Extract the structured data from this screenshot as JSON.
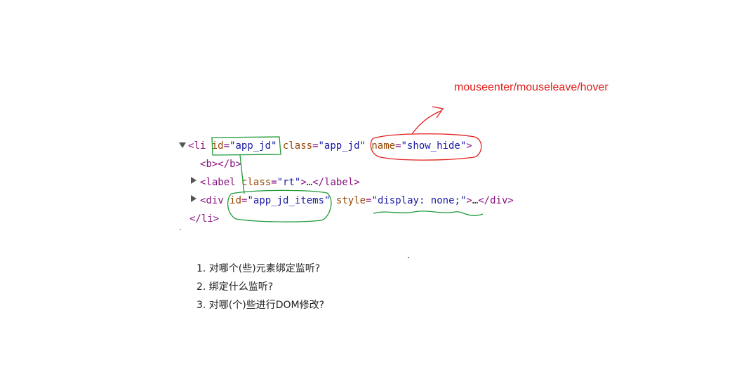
{
  "annotation": {
    "text": "mouseenter/mouseleave/hover",
    "color": "#e0201c"
  },
  "code": {
    "line1": {
      "open": "<",
      "tag": "li",
      "attr1_name": "id",
      "attr1_eq": "=",
      "attr1_value": "\"app_jd\"",
      "attr2_name": "class",
      "attr2_eq": "=",
      "attr2_value": "\"app_jd\"",
      "attr3_name": "name",
      "attr3_eq": "=",
      "attr3_value": "\"show_hide\"",
      "close": ">"
    },
    "line2": {
      "text_open": "<",
      "tag": "b",
      "mid": "></",
      "tag_close": "b",
      "close": ">"
    },
    "line3": {
      "open": "<",
      "tag": "label",
      "attr_name": "class",
      "attr_eq": "=",
      "attr_value": "\"rt\"",
      "mid": ">",
      "ellipsis": "…",
      "end_open": "</",
      "end_tag": "label",
      "end_close": ">"
    },
    "line4": {
      "open": "<",
      "tag": "div",
      "attr1_name": "id",
      "attr1_eq": "=",
      "attr1_value": "\"app_jd_items\"",
      "attr2_name": "style",
      "attr2_eq": "=",
      "attr2_value": "\"display: none;\"",
      "mid": ">",
      "ellipsis": "…",
      "end_open": "</",
      "end_tag": "div",
      "end_close": ">"
    },
    "line5": {
      "open": "</",
      "tag": "li",
      "close": ">"
    }
  },
  "questions": [
    "1. 对哪个(些)元素绑定监听?",
    "2. 绑定什么监听?",
    "3. 对哪(个)些进行DOM修改?"
  ],
  "colors": {
    "red_ink": "#e0201c",
    "green_ink": "#1f9a3a",
    "tag": "#881280",
    "attr": "#994500",
    "value": "#1a1aa6"
  }
}
